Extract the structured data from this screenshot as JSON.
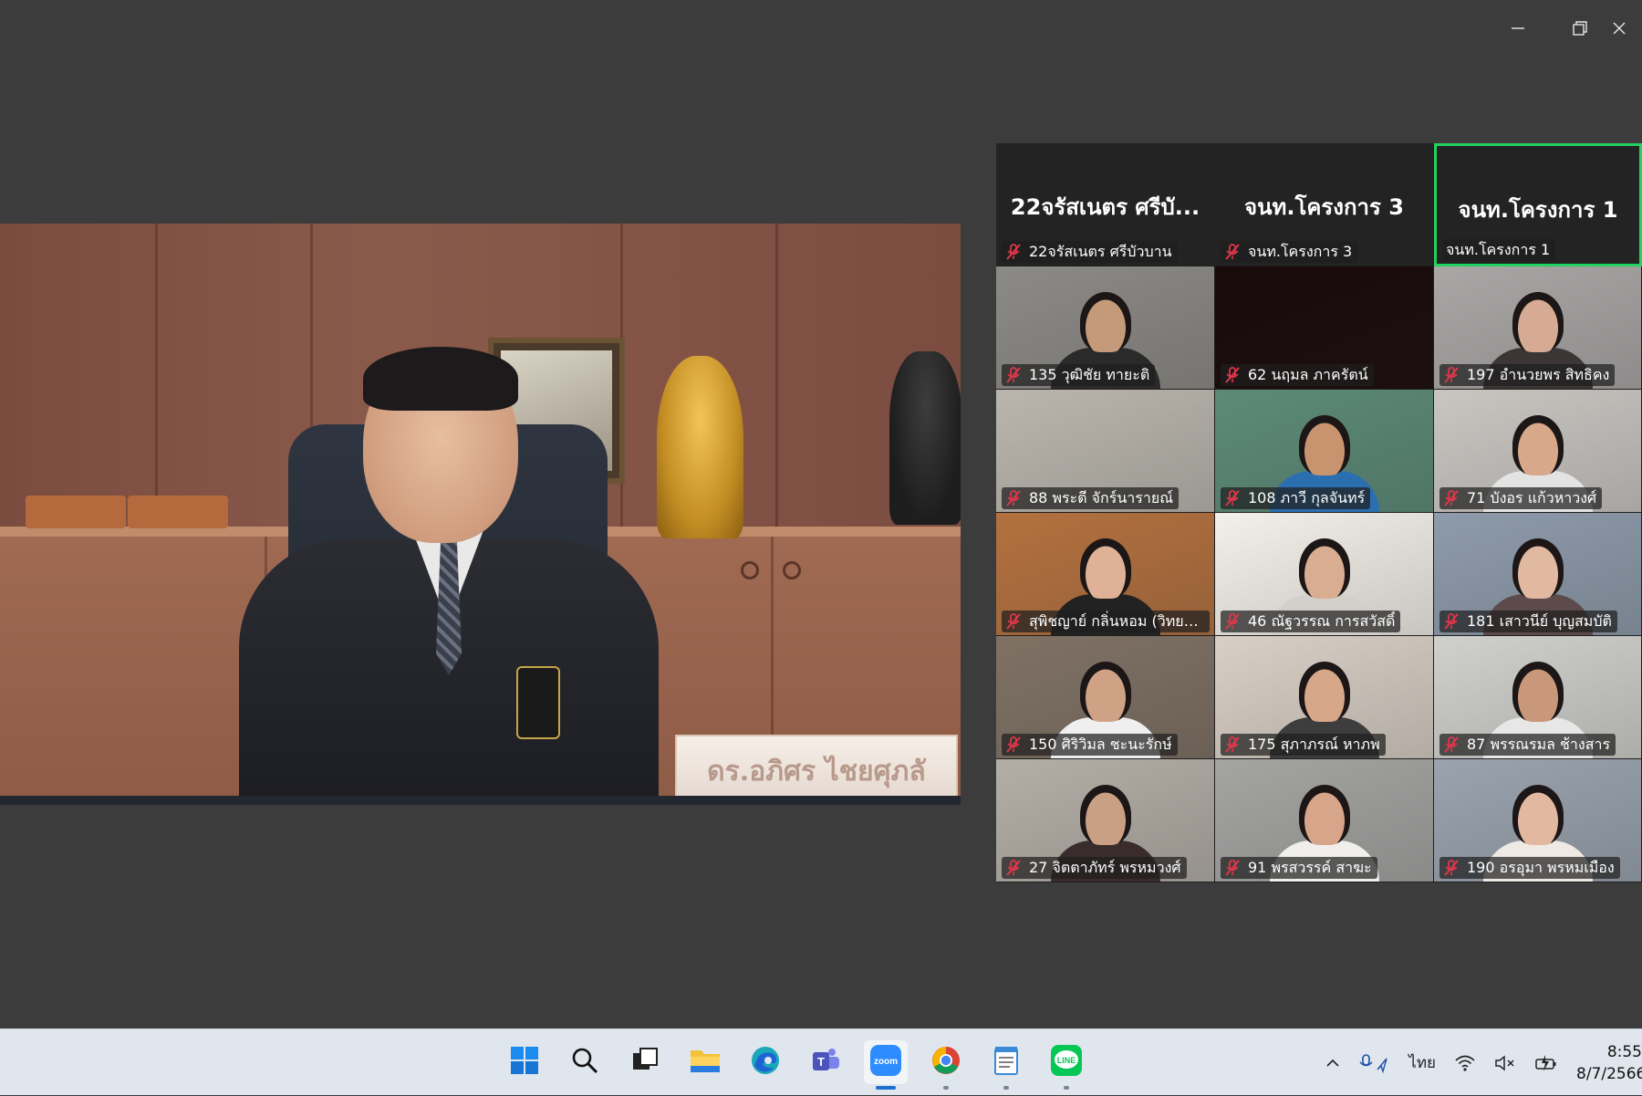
{
  "window": {
    "controls": [
      "minimize",
      "restore",
      "close"
    ]
  },
  "main_speaker": {
    "nameplate": "ดร.อภิศร ไชยศุภลั"
  },
  "gallery": {
    "header_tiles": [
      {
        "big_name": "22จรัสเนตร ศรีบั...",
        "label": "22จรัสเนตร ศรีบัวบาน",
        "muted": true
      },
      {
        "big_name": "จนท.โครงการ 3",
        "label": "จนท.โครงการ 3",
        "muted": true
      },
      {
        "big_name": "จนท.โครงการ 1",
        "label": "จนท.โครงการ 1",
        "muted": false,
        "active": true
      }
    ],
    "tiles": [
      {
        "label": "135 วุฒิชัย ทายะติ",
        "muted": true,
        "bg": "#8c8a86",
        "skin": "#c59a7a",
        "shirt": "#2a2a2a"
      },
      {
        "label": "62 นฤมล ภาครัตน์",
        "muted": true,
        "bg": "#1a0b0b",
        "skin": "",
        "shirt": ""
      },
      {
        "label": "197 อำนวยพร สิทธิคง",
        "muted": true,
        "bg": "#a9a7a6",
        "skin": "#d7ab93",
        "shirt": "#3b3535"
      },
      {
        "label": "88 พระตี จักร์นารายณ์",
        "muted": true,
        "bg": "#bab6ae",
        "skin": "",
        "shirt": ""
      },
      {
        "label": "108 ภาวี กุลจันทร์",
        "muted": true,
        "bg": "#5c8a78",
        "skin": "#c89470",
        "shirt": "#2b6fb0"
      },
      {
        "label": "71 บังอร แก้วหาวงศ์",
        "muted": true,
        "bg": "#c9c6c2",
        "skin": "#d7a889",
        "shirt": "#e3e3e3"
      },
      {
        "label": "สุพิชญาย์ กลิ่นหอม (วิทยา...",
        "muted": true,
        "bg": "#b3713f",
        "skin": "#dfb297",
        "shirt": "#222222"
      },
      {
        "label": "46 ณัฐวรรณ การสวัสดิ์",
        "muted": true,
        "bg": "#f3efe9",
        "skin": "#d9ad92",
        "shirt": "#d3d0cc"
      },
      {
        "label": "181 เสาวนีย์ บุญสมบัติ",
        "muted": true,
        "bg": "#8e9bab",
        "skin": "#e1b8a0",
        "shirt": "#5d4a4a"
      },
      {
        "label": "150 ศิริวิมล ชะนะรักษ์",
        "muted": true,
        "bg": "#7f7164",
        "skin": "#d0a285",
        "shirt": "#efefef"
      },
      {
        "label": "175 สุภาภรณ์ หาภพ",
        "muted": true,
        "bg": "#d8cfc5",
        "skin": "#d6a889",
        "shirt": "#3d3d3d"
      },
      {
        "label": "87 พรรณรมล ช้างสาร",
        "muted": true,
        "bg": "#d0d0cc",
        "skin": "#c9977a",
        "shirt": "#e7e7e7"
      },
      {
        "label": "27 จิตตาภัทร์ พรหมวงศ์",
        "muted": true,
        "bg": "#b3aea6",
        "skin": "#caa084",
        "shirt": "#3a2c2c"
      },
      {
        "label": "91 พรสวรรค์ สาฆะ",
        "muted": true,
        "bg": "#a4a5a3",
        "skin": "#d6a58a",
        "shirt": "#f0efed"
      },
      {
        "label": "190 อรอุมา พรหมเมือง",
        "muted": true,
        "bg": "#9aa3ae",
        "skin": "#e2b8a1",
        "shirt": "#efe9e4"
      }
    ]
  },
  "taskbar": {
    "apps": [
      {
        "name": "start",
        "icon": "windows-icon",
        "active": false,
        "running": false
      },
      {
        "name": "search",
        "icon": "search-icon",
        "active": false,
        "running": false
      },
      {
        "name": "task-view",
        "icon": "task-view-icon",
        "active": false,
        "running": false
      },
      {
        "name": "file-explorer",
        "icon": "folder-icon",
        "active": false,
        "running": false
      },
      {
        "name": "edge",
        "icon": "edge-icon",
        "active": false,
        "running": false
      },
      {
        "name": "teams",
        "icon": "teams-icon",
        "active": false,
        "running": false
      },
      {
        "name": "zoom",
        "icon": "zoom-icon",
        "label": "zoom",
        "active": true,
        "running": true
      },
      {
        "name": "chrome",
        "icon": "chrome-icon",
        "active": false,
        "running": true
      },
      {
        "name": "notepad",
        "icon": "notepad-icon",
        "active": false,
        "running": true
      },
      {
        "name": "line",
        "icon": "line-icon",
        "label": "LINE",
        "active": false,
        "running": true
      }
    ],
    "tray": {
      "language": "ไทย",
      "time": "8:55",
      "date": "8/7/2566"
    }
  },
  "colors": {
    "window_bg": "#3c3c3c",
    "gallery_bg": "#1f1f1f",
    "active_speaker_border": "#23d160",
    "muted_red": "#e0364a",
    "taskbar_bg": "#dfe6ee"
  }
}
